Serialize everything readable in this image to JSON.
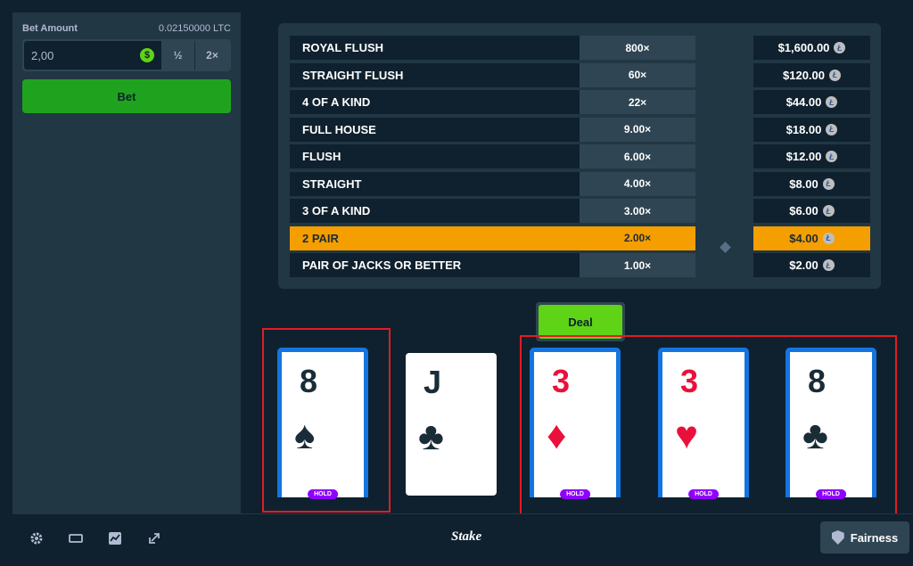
{
  "bet": {
    "label": "Bet Amount",
    "balance": "0.02150000 LTC",
    "amount": "2,00",
    "half": "½",
    "double": "2×",
    "bet_button": "Bet",
    "currency_icon": "dollar-coin-icon"
  },
  "paytable": [
    {
      "hand": "ROYAL FLUSH",
      "mult": "800×",
      "payout": "$1,600.00"
    },
    {
      "hand": "STRAIGHT FLUSH",
      "mult": "60×",
      "payout": "$120.00"
    },
    {
      "hand": "4 OF A KIND",
      "mult": "22×",
      "payout": "$44.00"
    },
    {
      "hand": "FULL HOUSE",
      "mult": "9.00×",
      "payout": "$18.00"
    },
    {
      "hand": "FLUSH",
      "mult": "6.00×",
      "payout": "$12.00"
    },
    {
      "hand": "STRAIGHT",
      "mult": "4.00×",
      "payout": "$8.00"
    },
    {
      "hand": "3 OF A KIND",
      "mult": "3.00×",
      "payout": "$6.00"
    },
    {
      "hand": "2 PAIR",
      "mult": "2.00×",
      "payout": "$4.00"
    },
    {
      "hand": "PAIR OF JACKS OR BETTER",
      "mult": "1.00×",
      "payout": "$2.00"
    }
  ],
  "active_hand": "2 PAIR",
  "ltc_symbol": "Ł",
  "deal_button": "Deal",
  "hold_label": "HOLD",
  "cards": [
    {
      "rank": "8",
      "suit": "♠",
      "color": "black",
      "held": true
    },
    {
      "rank": "J",
      "suit": "♣",
      "color": "black",
      "held": false
    },
    {
      "rank": "3",
      "suit": "♦",
      "color": "red",
      "held": true
    },
    {
      "rank": "3",
      "suit": "♥",
      "color": "red",
      "held": true
    },
    {
      "rank": "8",
      "suit": "♣",
      "color": "black",
      "held": true
    }
  ],
  "footer": {
    "brand": "Stake",
    "fairness": "Fairness",
    "icons": [
      "settings-icon",
      "theatre-mode-icon",
      "stats-icon",
      "popout-icon"
    ]
  },
  "colors": {
    "bg": "#0f212e",
    "panel": "#213743",
    "bet_green": "#1fa31f",
    "deal_green": "#5fd316",
    "highlight": "#f59e00",
    "hold_purple": "#9000ff",
    "held_border": "#1475e1",
    "annotation_red": "#e31b23"
  }
}
